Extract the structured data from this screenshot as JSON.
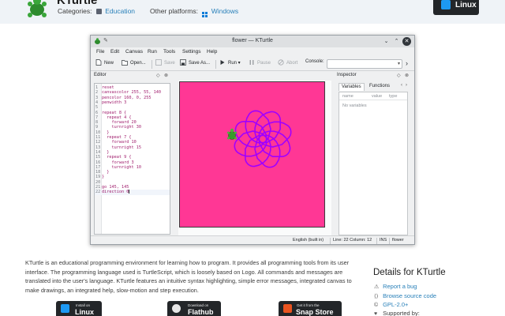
{
  "page": {
    "app_title": "KTurtle",
    "categories_label": "Categories:",
    "category": "Education",
    "platforms_label": "Other platforms:",
    "platform": "Windows",
    "top_badge": "Linux"
  },
  "window": {
    "title": "flower — KTurtle",
    "menu": [
      "File",
      "Edit",
      "Canvas",
      "Run",
      "Tools",
      "Settings",
      "Help"
    ],
    "toolbar": {
      "new": "New",
      "open": "Open...",
      "save": "Save",
      "save_as": "Save As...",
      "run": "Run",
      "pause": "Pause",
      "abort": "Abort",
      "console_label": "Console:",
      "console_value": ""
    },
    "editor": {
      "title": "Editor",
      "lines": [
        {
          "n": "1",
          "text": "reset"
        },
        {
          "n": "2",
          "text": "canvascolor 255, 55, 140"
        },
        {
          "n": "3",
          "text": "pencolor 160, 0, 255"
        },
        {
          "n": "4",
          "text": "penwidth 3"
        },
        {
          "n": "5",
          "text": ""
        },
        {
          "n": "6",
          "text": "repeat 8 {"
        },
        {
          "n": "7",
          "text": "  repeat 4 {"
        },
        {
          "n": "8",
          "text": "    forward 20"
        },
        {
          "n": "9",
          "text": "    turnright 30"
        },
        {
          "n": "10",
          "text": "  }"
        },
        {
          "n": "11",
          "text": "  repeat 7 {"
        },
        {
          "n": "12",
          "text": "    forward 10"
        },
        {
          "n": "13",
          "text": "    turnright 15"
        },
        {
          "n": "14",
          "text": "  }"
        },
        {
          "n": "15",
          "text": "  repeat 9 {"
        },
        {
          "n": "16",
          "text": "    forward 3"
        },
        {
          "n": "17",
          "text": "    turnright 10"
        },
        {
          "n": "18",
          "text": "  }"
        },
        {
          "n": "19",
          "text": "}"
        },
        {
          "n": "20",
          "text": ""
        },
        {
          "n": "21",
          "text": "go 145, 145"
        },
        {
          "n": "22",
          "text": "direction 0"
        }
      ]
    },
    "inspector": {
      "title": "Inspector",
      "tabs": [
        "Variables",
        "Functions"
      ],
      "columns": [
        "name",
        "value",
        "type"
      ],
      "empty_text": "No variables"
    },
    "status": {
      "language": "English (built in)",
      "position": "Line: 22 Column: 12",
      "mode": "INS",
      "file": "flower"
    },
    "canvas": {
      "background_color": "#ff3795",
      "pen_color": "#a000ff",
      "turtle_color": "#3a9a2a"
    }
  },
  "description": "KTurtle is an educational programming environment for learning how to program. It provides all programming tools from its user interface. The programming language used is TurtleScript, which is loosely based on Logo. All commands and messages are translated into the user's language. KTurtle features an intuitive syntax highlighting, simple error messages, integrated canvas to make drawings, an integrated help, slow-motion and step execution.",
  "details": {
    "title": "Details for KTurtle",
    "items": [
      {
        "icon": "bug-icon",
        "glyph": "⚠",
        "text": "Report a bug"
      },
      {
        "icon": "code-icon",
        "glyph": "⟨⟩",
        "text": "Browse source code"
      },
      {
        "icon": "license-icon",
        "glyph": "©",
        "text": "GPL-2.0+"
      },
      {
        "icon": "heart-icon",
        "glyph": "♥",
        "text": "Supported by:"
      }
    ]
  },
  "store_badges": [
    {
      "small": "Install on",
      "big": "Linux"
    },
    {
      "small": "Download on",
      "big": "Flathub"
    },
    {
      "small": "Get it from the",
      "big": "Snap Store"
    }
  ]
}
